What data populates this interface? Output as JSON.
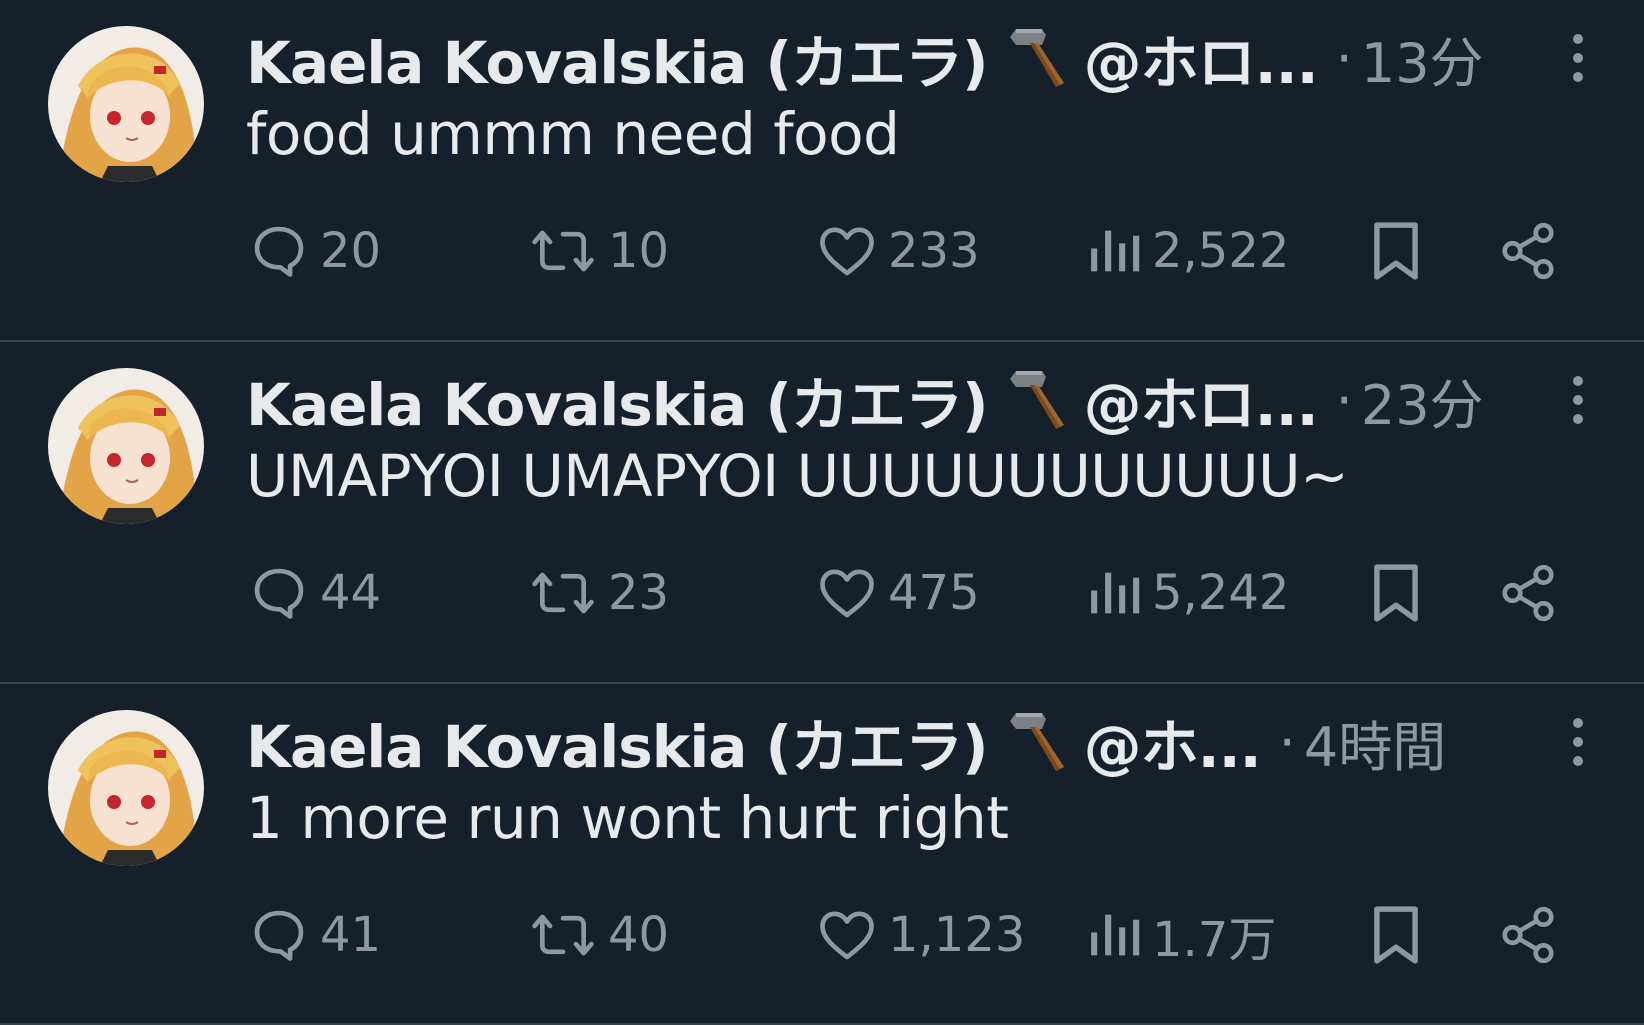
{
  "colors": {
    "background": "#15202b",
    "text": "#e7e9ea",
    "muted": "#8b98a5",
    "divider": "#38444d"
  },
  "tweets": [
    {
      "name": "Kaela Kovalskia (カエラ)",
      "handle": "@ホロ...",
      "time": "13分",
      "text": "food ummm need food",
      "replies": "20",
      "retweets": "10",
      "likes": "233",
      "views": "2,522"
    },
    {
      "name": "Kaela Kovalskia (カエラ)",
      "handle": "@ホロ...",
      "time": "23分",
      "text": "UMAPYOI UMAPYOI UUUUUUUUUUUU~",
      "replies": "44",
      "retweets": "23",
      "likes": "475",
      "views": "5,242"
    },
    {
      "name": "Kaela Kovalskia (カエラ)",
      "handle": "@ホ...",
      "time": "4時間",
      "text": "1 more run wont hurt right",
      "replies": "41",
      "retweets": "40",
      "likes": "1,123",
      "views": "1.7万"
    }
  ],
  "separator": "·",
  "icons": {
    "name_emoji": "hammer-emoji-icon",
    "more": "more-dots-icon",
    "reply": "reply-bubble-icon",
    "retweet": "retweet-icon",
    "like": "heart-icon",
    "views": "views-bar-chart-icon",
    "bookmark": "bookmark-icon",
    "share": "share-icon"
  }
}
